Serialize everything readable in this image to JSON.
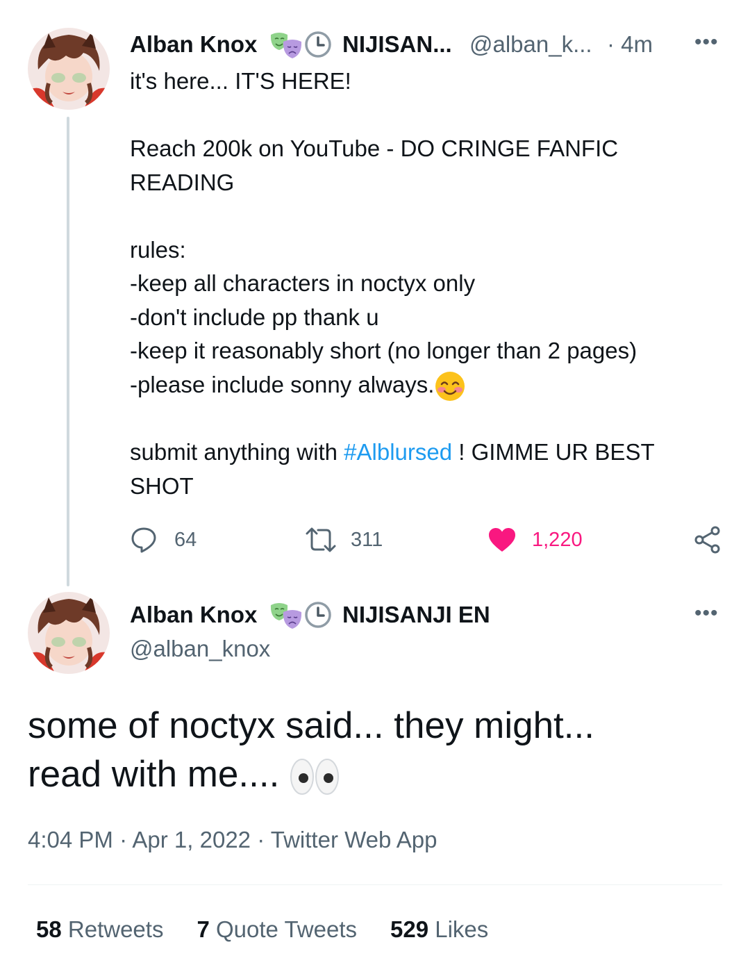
{
  "tweet1": {
    "author_name": "Alban Knox",
    "affiliation": "NIJISAN...",
    "handle": "@alban_k...",
    "time": "· 4m",
    "more": "•••",
    "lines": [
      "it's here... IT'S HERE!",
      "",
      "Reach 200k on YouTube - DO CRINGE FANFIC",
      "READING",
      "",
      "rules:",
      "-keep all characters in noctyx only",
      "-don't include pp thank u",
      "-keep it reasonably short (no longer than 2 pages)",
      "-please include sonny always."
    ],
    "submit_prefix": "submit anything with ",
    "hashtag": "#Alblursed",
    "submit_suffix": " ! GIMME UR BEST",
    "submit_line2": "SHOT",
    "replies": "64",
    "retweets": "311",
    "likes": "1,220",
    "like_color": "#f91880",
    "icons": [
      "reply-icon",
      "retweet-icon",
      "heart-icon",
      "share-icon",
      "smiling-face-emoji"
    ]
  },
  "tweet2": {
    "author_name": "Alban Knox",
    "affiliation": "NIJISANJI EN",
    "handle": "@alban_knox",
    "more": "•••",
    "text_line1": "some of noctyx said... they might...",
    "text_line2": "read with me....",
    "timestamp": "4:04 PM · Apr 1, 2022 · Twitter Web App",
    "stats": {
      "retweets_count": "58",
      "retweets_label": "Retweets",
      "quotes_count": "7",
      "quotes_label": "Quote Tweets",
      "likes_count": "529",
      "likes_label": "Likes"
    },
    "icons": [
      "eyes-emoji"
    ]
  },
  "badge_icons": [
    "theater-masks-icon",
    "clock-icon"
  ],
  "accent_color": "#1d9bf0"
}
